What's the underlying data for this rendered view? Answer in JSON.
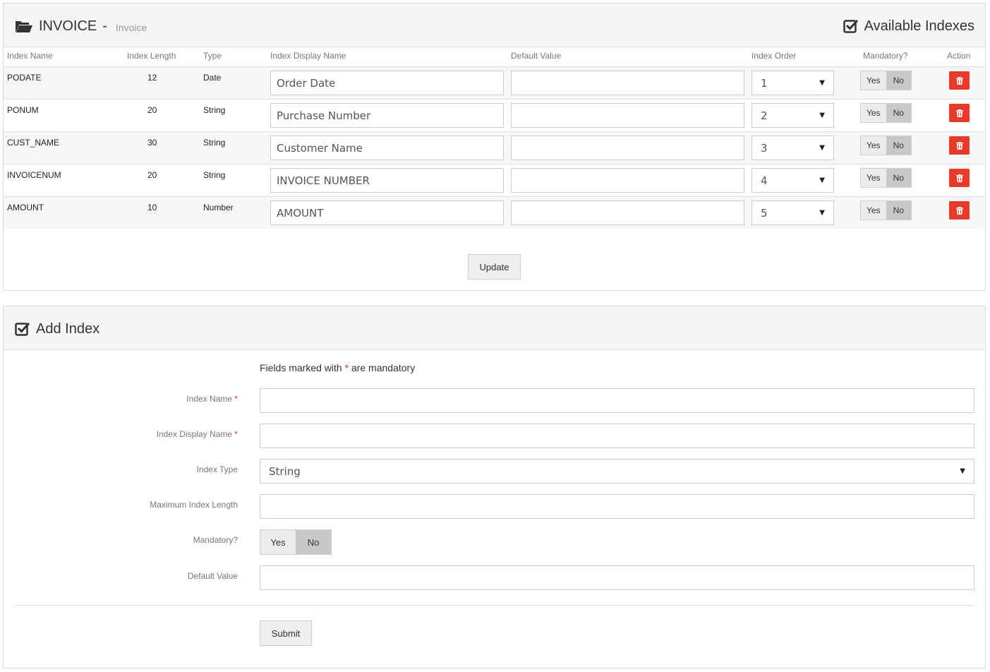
{
  "indexes_panel": {
    "title": "INVOICE",
    "separator": "-",
    "subtitle": "Invoice",
    "available_label": "Available Indexes",
    "columns": [
      "Index Name",
      "Index Length",
      "Type",
      "Index Display Name",
      "Default Value",
      "Index Order",
      "Mandatory?",
      "Action"
    ],
    "rows": [
      {
        "name": "PODATE",
        "length": "12",
        "type": "Date",
        "display_name": "Order Date",
        "default_value": "",
        "order": "1",
        "mandatory_yes": "Yes",
        "mandatory_no": "No"
      },
      {
        "name": "PONUM",
        "length": "20",
        "type": "String",
        "display_name": "Purchase Number",
        "default_value": "",
        "order": "2",
        "mandatory_yes": "Yes",
        "mandatory_no": "No"
      },
      {
        "name": "CUST_NAME",
        "length": "30",
        "type": "String",
        "display_name": "Customer Name",
        "default_value": "",
        "order": "3",
        "mandatory_yes": "Yes",
        "mandatory_no": "No"
      },
      {
        "name": "INVOICENUM",
        "length": "20",
        "type": "String",
        "display_name": "INVOICE NUMBER",
        "default_value": "",
        "order": "4",
        "mandatory_yes": "Yes",
        "mandatory_no": "No"
      },
      {
        "name": "AMOUNT",
        "length": "10",
        "type": "Number",
        "display_name": "AMOUNT",
        "default_value": "",
        "order": "5",
        "mandatory_yes": "Yes",
        "mandatory_no": "No"
      }
    ],
    "update_label": "Update"
  },
  "add_panel": {
    "title": "Add Index",
    "note_prefix": "Fields marked with",
    "note_star": "*",
    "note_suffix": "are mandatory",
    "fields": {
      "index_name_label": "Index Name",
      "display_name_label": "Index Display Name",
      "index_type_label": "Index Type",
      "index_type_value": "String",
      "max_length_label": "Maximum Index Length",
      "mandatory_label": "Mandatory?",
      "mandatory_yes": "Yes",
      "mandatory_no": "No",
      "default_value_label": "Default Value"
    },
    "star": "*",
    "submit_label": "Submit"
  },
  "colors": {
    "delete": "#e83a2b",
    "required": "#d9302c",
    "panel_head": "#f5f5f5"
  },
  "icons": [
    "folder-open-icon",
    "check-square-icon",
    "trash-icon"
  ]
}
